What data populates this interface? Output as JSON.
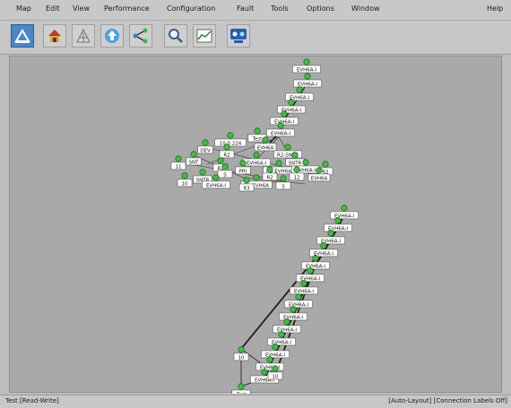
{
  "menubar": {
    "items": [
      "Map",
      "Edit",
      "View",
      "Performance",
      "Configuration",
      "Fault",
      "Tools",
      "Options",
      "Window",
      "Help"
    ]
  },
  "toolbar": {
    "buttons": [
      {
        "icon": "network-map-icon"
      },
      {
        "icon": "house-icon"
      },
      {
        "icon": "topology-icon"
      },
      {
        "icon": "upload-icon"
      },
      {
        "icon": "connections-icon"
      },
      {
        "icon": "zoom-icon"
      },
      {
        "icon": "chart-icon"
      },
      {
        "icon": "network-icon"
      }
    ]
  },
  "map": {
    "upper_chain_labels": [
      "EVH6A-I",
      "EVH6A-I",
      "EVH6A-I",
      "EVH6A-I",
      "EVH6A-I",
      "EVH6A-I"
    ],
    "cluster_labels": [
      "Test",
      "10.0.224",
      "EVH6A",
      "DEV",
      "R2",
      "R2-SNTR",
      "SNT",
      "EVH6A-I",
      "SNTR",
      "11",
      "R2",
      "PRI",
      "R2-EVH6A",
      "EVH6A-I",
      "R2",
      "S",
      "R2",
      "12",
      "EVH6A",
      "SNTR",
      "10",
      "EVH6A-I",
      "R2-EVH6A",
      "S",
      "R3"
    ],
    "lower_chain_labels": [
      "EVH6A-I",
      "EVH6A-I",
      "EVH6A-I",
      "EVH6A-I",
      "EVH6A-I",
      "EVH6A-I",
      "EVH6A-I",
      "EVH6A-I",
      "EVH6A-I",
      "EVH6A-I",
      "EVH6A-I",
      "EVH6A-I",
      "EVH6A-I",
      "EVH6A-I"
    ],
    "bottom_labels": [
      "10",
      "10",
      "Test"
    ]
  },
  "status": {
    "left": "Test [Read-Write]",
    "right": "[Auto-Layout] [Connection Labels Off]"
  }
}
